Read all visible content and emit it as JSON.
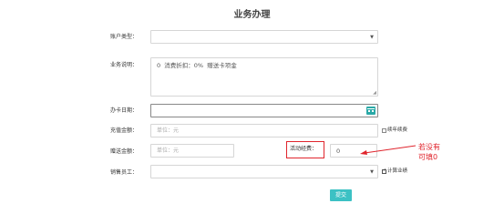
{
  "page": {
    "title": "业务办理"
  },
  "form": {
    "account_type": {
      "label": "账户类型：",
      "value": ""
    },
    "business_desc": {
      "label": "业务说明：",
      "value": "0  消费折扣：0%  赠送卡项金"
    },
    "card_date": {
      "label": "办卡日期：",
      "value": ""
    },
    "recharge": {
      "label": "充值金额：",
      "placeholder": "单位：元",
      "option_label": "续年续费"
    },
    "gift": {
      "label": "赠送金额：",
      "placeholder": "单位：元"
    },
    "activity_fee": {
      "label": "活动经费：",
      "value": "0"
    },
    "sales_staff": {
      "label": "销售员工：",
      "value": "",
      "option_label": "计算业绩"
    },
    "submit_label": "提交"
  },
  "annotation": {
    "line1": "若没有",
    "line2": "可填0"
  },
  "colors": {
    "submit_bg": "#3cc1c4",
    "annotation": "#e0252d",
    "calendar_icon": "#2aa9a7"
  },
  "icons": {
    "calendar": "calendar-icon",
    "dropdown": "chevron-down-icon"
  }
}
